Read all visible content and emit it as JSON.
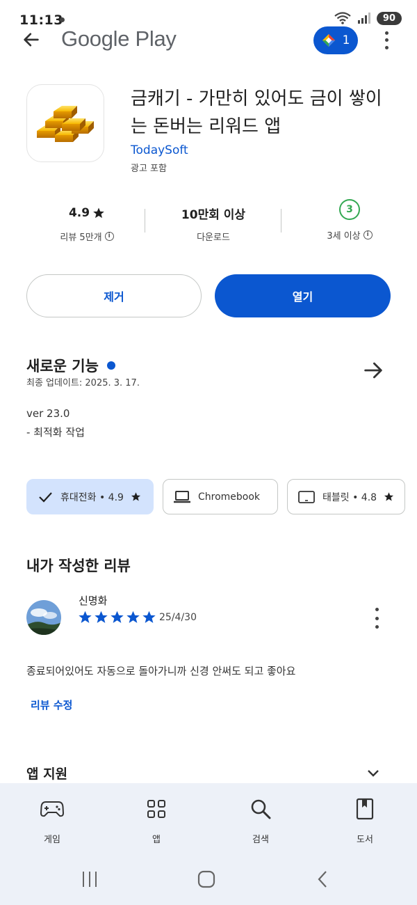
{
  "status": {
    "time": "11:13",
    "battery": "90"
  },
  "topbar": {
    "title": "Google Play",
    "badge_count": "1"
  },
  "app": {
    "title": "금캐기 - 가만히 있어도 금이 쌓이는 돈버는 리워드 앱",
    "developer": "TodaySoft",
    "ads_label": "광고 포함"
  },
  "stats": {
    "rating_value": "4.9",
    "rating_label": "리뷰 5만개",
    "downloads_value": "10만회 이상",
    "downloads_label": "다운로드",
    "age_value": "3",
    "age_label": "3세 이상"
  },
  "actions": {
    "remove": "제거",
    "open": "열기"
  },
  "whats_new": {
    "title": "새로운 기능",
    "updated": "최종 업데이트: 2025. 3. 17.",
    "notes": [
      "ver 23.0",
      "- 최적화 작업"
    ]
  },
  "devices": [
    {
      "label": "휴대전화 • 4.9",
      "icon": "check-icon",
      "active": true
    },
    {
      "label": "Chromebook",
      "icon": "laptop-icon",
      "active": false
    },
    {
      "label": "태블릿 • 4.8",
      "icon": "tablet-icon",
      "active": false
    }
  ],
  "my_review": {
    "section_title": "내가 작성한 리뷰",
    "reviewer": "신명화",
    "stars": 5,
    "date": "25/4/30",
    "text": "종료되어있어도 자동으로 돌아가니까 신경 안써도 되고 좋아요",
    "edit_label": "리뷰 수정"
  },
  "support": {
    "title": "앱 지원"
  },
  "bottom_nav": [
    {
      "label": "게임",
      "icon": "gamepad-icon"
    },
    {
      "label": "앱",
      "icon": "apps-grid-icon"
    },
    {
      "label": "검색",
      "icon": "search-icon"
    },
    {
      "label": "도서",
      "icon": "book-icon"
    }
  ],
  "colors": {
    "accent": "#0b57d0",
    "chip_active": "#d3e3fd",
    "age_green": "#33a852",
    "nav_bg": "#edf1f8"
  }
}
